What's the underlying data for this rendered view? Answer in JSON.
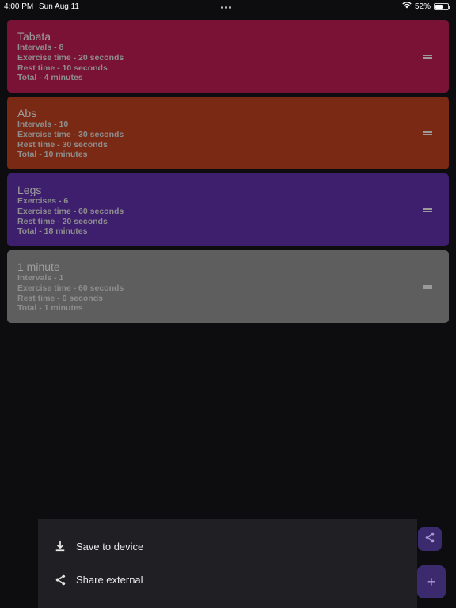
{
  "status_bar": {
    "time": "4:00 PM",
    "date": "Sun Aug 11",
    "battery": "52%",
    "battery_level": 0.52
  },
  "workouts": [
    {
      "title": "Tabata",
      "lines": [
        "Intervals - 8",
        "Exercise time - 20 seconds",
        "Rest time - 10 seconds",
        "Total - 4 minutes"
      ],
      "color": "#7a1236"
    },
    {
      "title": "Abs",
      "lines": [
        "Intervals - 10",
        "Exercise time - 30 seconds",
        "Rest time - 30 seconds",
        "Total - 10 minutes"
      ],
      "color": "#7a2a14"
    },
    {
      "title": "Legs",
      "lines": [
        "Exercises - 6",
        "Exercise time - 60 seconds",
        "Rest time - 20 seconds",
        "Total - 18 minutes"
      ],
      "color": "#3e1f6e"
    },
    {
      "title": "1 minute",
      "lines": [
        "Intervals - 1",
        "Exercise time - 60 seconds",
        "Rest time - 0 seconds",
        "Total - 1 minutes"
      ],
      "color": "#5e5e5e"
    }
  ],
  "share_sheet": {
    "save_label": "Save to device",
    "share_label": "Share external"
  },
  "fab": {
    "add_symbol": "+"
  },
  "icons": {
    "download": "download-icon",
    "share": "share-icon",
    "wifi": "wifi-icon",
    "battery": "battery-icon",
    "drag": "drag-handle-icon"
  }
}
